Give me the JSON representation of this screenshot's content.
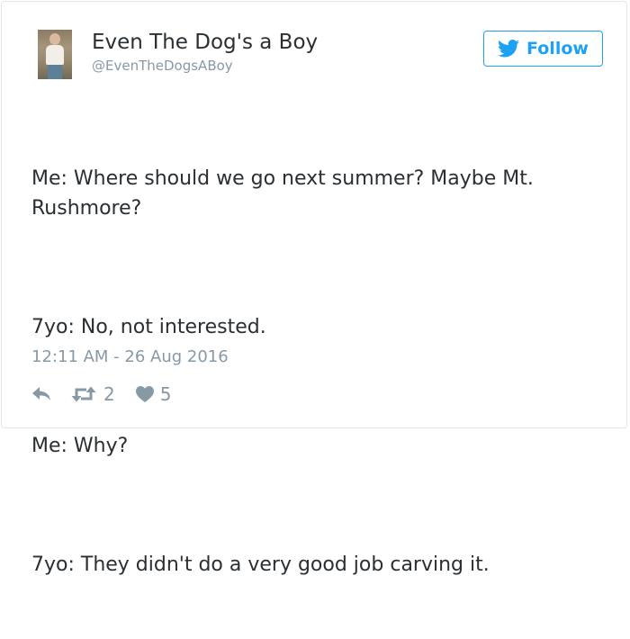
{
  "user": {
    "display_name": "Even The Dog's a Boy",
    "handle": "@EvenTheDogsABoy"
  },
  "follow_button": {
    "label": "Follow",
    "icon": "twitter-bird-icon",
    "color": "#1da1f2"
  },
  "tweet": {
    "lines": [
      "Me: Where should we go next summer? Maybe Mt. Rushmore?",
      "7yo: No, not interested.",
      "Me: Why?",
      "7yo: They didn't do a very good job carving it."
    ],
    "timestamp": "12:11 AM - 26 Aug 2016"
  },
  "actions": {
    "reply_icon": "reply-icon",
    "retweet_icon": "retweet-icon",
    "retweet_count": "2",
    "like_icon": "heart-icon",
    "like_count": "5"
  },
  "colors": {
    "text": "#292f33",
    "muted": "#8899a6",
    "accent": "#1da1f2",
    "border": "#e1e8ed"
  }
}
